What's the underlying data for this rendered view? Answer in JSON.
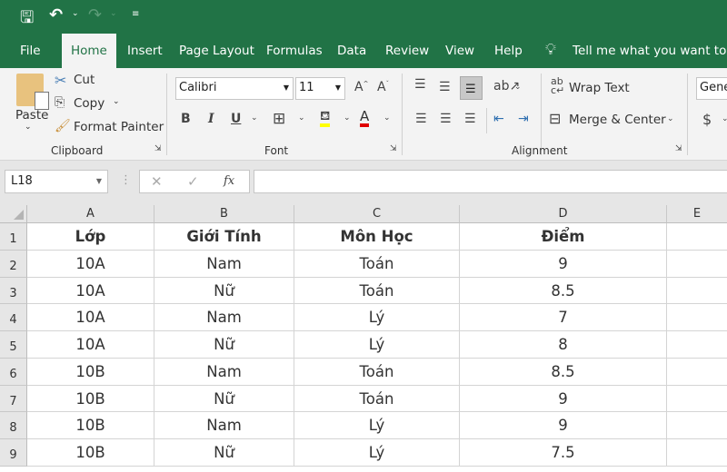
{
  "quick_access": {
    "save_icon": "save-icon",
    "undo_icon": "undo-icon",
    "redo_icon": "redo-icon",
    "customize_icon": "customize-icon"
  },
  "tabs": [
    "File",
    "Home",
    "Insert",
    "Page Layout",
    "Formulas",
    "Data",
    "Review",
    "View",
    "Help"
  ],
  "active_tab": "Home",
  "tell_me": "Tell me what you want to do",
  "clipboard": {
    "paste": "Paste",
    "cut": "Cut",
    "copy": "Copy",
    "format_painter": "Format Painter",
    "label": "Clipboard"
  },
  "font": {
    "name": "Calibri",
    "size": "11",
    "bold": "B",
    "italic": "I",
    "underline": "U",
    "label": "Font",
    "fill_color": "#ffff00",
    "font_color": "#e00000"
  },
  "alignment": {
    "wrap_text": "Wrap Text",
    "merge_center": "Merge & Center",
    "label": "Alignment"
  },
  "number": {
    "format": "General",
    "currency": "$"
  },
  "formula_bar": {
    "name_box": "L18",
    "fx": "fx",
    "cancel": "✕",
    "enter": "✓",
    "value": ""
  },
  "columns": [
    "A",
    "B",
    "C",
    "D",
    "E"
  ],
  "rows": [
    "1",
    "2",
    "3",
    "4",
    "5",
    "6",
    "7",
    "8",
    "9"
  ],
  "table": {
    "headers": [
      "Lớp",
      "Giới Tính",
      "Môn Học",
      "Điểm"
    ],
    "data": [
      [
        "10A",
        "Nam",
        "Toán",
        "9"
      ],
      [
        "10A",
        "Nữ",
        "Toán",
        "8.5"
      ],
      [
        "10A",
        "Nam",
        "Lý",
        "7"
      ],
      [
        "10A",
        "Nữ",
        "Lý",
        "8"
      ],
      [
        "10B",
        "Nam",
        "Toán",
        "8.5"
      ],
      [
        "10B",
        "Nữ",
        "Toán",
        "9"
      ],
      [
        "10B",
        "Nam",
        "Lý",
        "9"
      ],
      [
        "10B",
        "Nữ",
        "Lý",
        "7.5"
      ]
    ]
  },
  "colors": {
    "brand": "#217346"
  }
}
